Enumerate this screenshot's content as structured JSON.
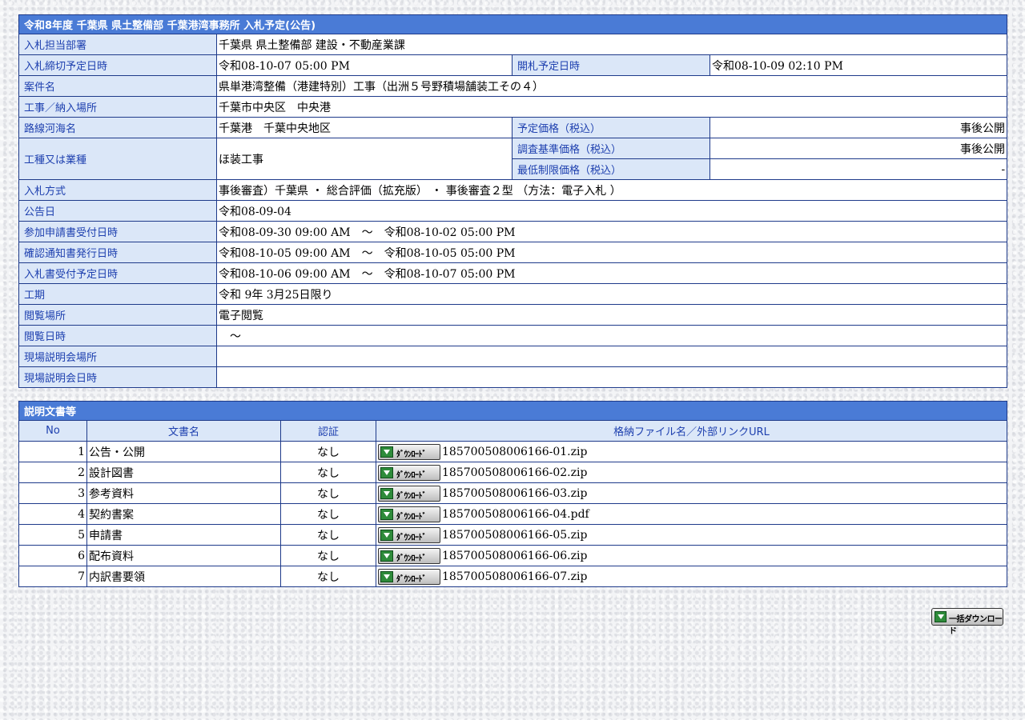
{
  "colors": {
    "header_bg": "#4a7bd6",
    "label_bg": "#dbe7f8",
    "label_text": "#1e40af",
    "border": "#1e3a8a"
  },
  "main": {
    "title": "令和8年度 千葉県 県土整備部 千葉港湾事務所 入札予定(公告)",
    "dept_label": "入札担当部署",
    "dept_value": "千葉県 県土整備部 建設・不動産業課",
    "deadline_label": "入札締切予定日時",
    "deadline_value": "令和08-10-07 05:00 PM",
    "opening_label": "開札予定日時",
    "opening_value": "令和08-10-09 02:10 PM",
    "case_label": "案件名",
    "case_value": "県単港湾整備（港建特別）工事（出洲５号野積場舗装工その４）",
    "place_label": "工事／納入場所",
    "place_value": "千葉市中央区　中央港",
    "route_label": "路線河海名",
    "route_value": "千葉港　千葉中央地区",
    "price_label": "予定価格（税込）",
    "price_value": "事後公開",
    "type_label": "工種又は業種",
    "type_value": "ほ装工事",
    "survey_label": "調査基準価格（税込）",
    "survey_value": "事後公開",
    "min_label": "最低制限価格（税込）",
    "min_value": "-",
    "method_label": "入札方式",
    "method_value": "事後審査）千葉県 ・ 総合評価（拡充版） ・ 事後審査２型 （方法：電子入札 ）",
    "notice_label": "公告日",
    "notice_value": "令和08-09-04",
    "apply_label": "参加申請書受付日時",
    "apply_value": "令和08-09-30 09:00 AM　～　令和08-10-02 05:00 PM",
    "confirm_label": "確認通知書発行日時",
    "confirm_value": "令和08-10-05 09:00 AM　～　令和08-10-05 05:00 PM",
    "receipt_label": "入札書受付予定日時",
    "receipt_value": "令和08-10-06 09:00 AM　～　令和08-10-07 05:00 PM",
    "period_label": "工期",
    "period_value": "令和 9年 3月25日限り",
    "view_place_label": "閲覧場所",
    "view_place_value": "電子閲覧",
    "view_date_label": "閲覧日時",
    "view_date_value": "　～",
    "site_place_label": "現場説明会場所",
    "site_place_value": "",
    "site_date_label": "現場説明会日時",
    "site_date_value": ""
  },
  "docs": {
    "title": "説明文書等",
    "col_no": "No",
    "col_name": "文書名",
    "col_auth": "認証",
    "col_file": "格納ファイル名／外部リンクURL",
    "download_label": "ﾀﾞｳﾝﾛｰﾄﾞ",
    "rows": [
      {
        "no": "1",
        "name": "公告・公開",
        "auth": "なし",
        "file": "185700508006166-01.zip"
      },
      {
        "no": "2",
        "name": "設計図書",
        "auth": "なし",
        "file": "185700508006166-02.zip"
      },
      {
        "no": "3",
        "name": "参考資料",
        "auth": "なし",
        "file": "185700508006166-03.zip"
      },
      {
        "no": "4",
        "name": "契約書案",
        "auth": "なし",
        "file": "185700508006166-04.pdf"
      },
      {
        "no": "5",
        "name": "申請書",
        "auth": "なし",
        "file": "185700508006166-05.zip"
      },
      {
        "no": "6",
        "name": "配布資料",
        "auth": "なし",
        "file": "185700508006166-06.zip"
      },
      {
        "no": "7",
        "name": "内訳書要領",
        "auth": "なし",
        "file": "185700508006166-07.zip"
      }
    ]
  },
  "bulk_download_label": "一括ダウンロード"
}
